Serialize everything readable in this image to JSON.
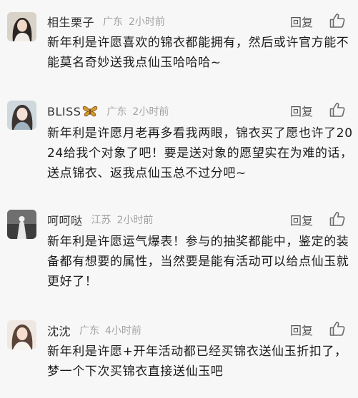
{
  "comments": [
    {
      "author": "相生栗子",
      "location": "广东",
      "time": "2小时前",
      "reply_label": "回复",
      "text": "新年利是许愿喜欢的锦衣都能拥有，然后或许官方能不能莫名奇妙送我点仙玉哈哈哈~"
    },
    {
      "author": "BLISS",
      "location": "广东",
      "time": "2小时前",
      "reply_label": "回复",
      "text": "新年利是许愿月老再多看我两眼，锦衣买了愿也许了2024给我个对象了吧！要是送对象的愿望实在为难的话，送点锦衣、返我点仙玉总不过分吧~"
    },
    {
      "author": "呵呵哒",
      "location": "江苏",
      "time": "2小时前",
      "reply_label": "回复",
      "text": "新年利是许愿运气爆表！参与的抽奖都能中，鉴定的装备都有想要的属性，当然要是能有活动可以给点仙玉就更好了！"
    },
    {
      "author": "沈沈",
      "location": "广东",
      "time": "4小时前",
      "reply_label": "回复",
      "text": "新年利是许愿+开年活动都已经买锦衣送仙玉折扣了，梦一个下次买锦衣直接送仙玉吧"
    }
  ],
  "icons": {
    "like": "thumbs-up-icon",
    "badge": "butterfly-icon"
  }
}
